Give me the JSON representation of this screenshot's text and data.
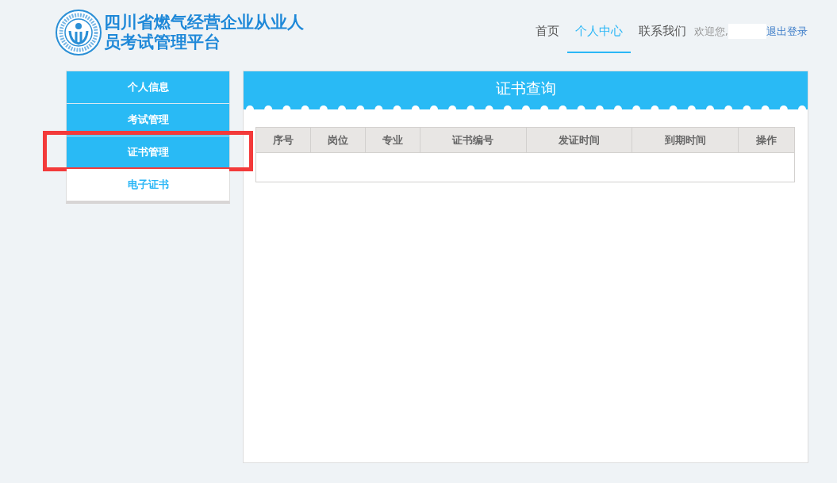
{
  "header": {
    "title_lines": [
      "四川省燃气经营企业从业人",
      "员考试管理平台"
    ],
    "nav": [
      {
        "label": "首页",
        "selected": false
      },
      {
        "label": "个人中心",
        "selected": true
      },
      {
        "label": "联系我们",
        "selected": false
      }
    ],
    "welcome": "欢迎您,",
    "logout": "退出登录"
  },
  "sidebar": {
    "items": [
      {
        "label": "个人信息",
        "kind": "menu",
        "annotated": false
      },
      {
        "label": "考试管理",
        "kind": "menu",
        "annotated": false
      },
      {
        "label": "证书管理",
        "kind": "menu",
        "annotated": true
      },
      {
        "label": "电子证书",
        "kind": "submenu",
        "annotated": false
      }
    ]
  },
  "panel": {
    "title": "证书查询",
    "table": {
      "columns": [
        "序号",
        "岗位",
        "专业",
        "证书编号",
        "发证时间",
        "到期时间",
        "操作"
      ]
    }
  }
}
